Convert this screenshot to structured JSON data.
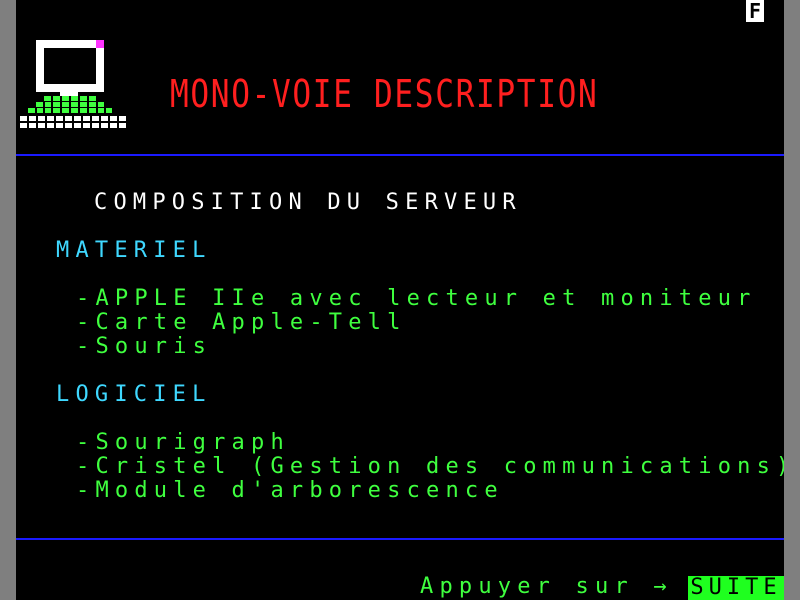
{
  "status": {
    "indicator": "F"
  },
  "header": {
    "title": "MONO-VOIE DESCRIPTION"
  },
  "content": {
    "heading": "COMPOSITION DU SERVEUR",
    "hardware": {
      "title": "MATERIEL",
      "items": [
        "-APPLE IIe avec lecteur et moniteur",
        "-Carte Apple-Tell",
        "-Souris"
      ]
    },
    "software": {
      "title": "LOGICIEL",
      "items": [
        "-Sourigraph",
        "-Cristel (Gestion des communications)",
        "-Module d'arborescence"
      ]
    }
  },
  "footer": {
    "prompt": "Appuyer sur →",
    "button_label": "SUITE"
  },
  "colors": {
    "background": "#000000",
    "title": "#ff1f1f",
    "heading": "#ffffff",
    "section": "#3fd8ff",
    "item": "#3fff3f",
    "rule": "#1a1aff",
    "button_bg": "#1fff1f",
    "logo_accent": "#ff33ff"
  },
  "icons": {
    "logo": "computer-terminal-icon"
  }
}
